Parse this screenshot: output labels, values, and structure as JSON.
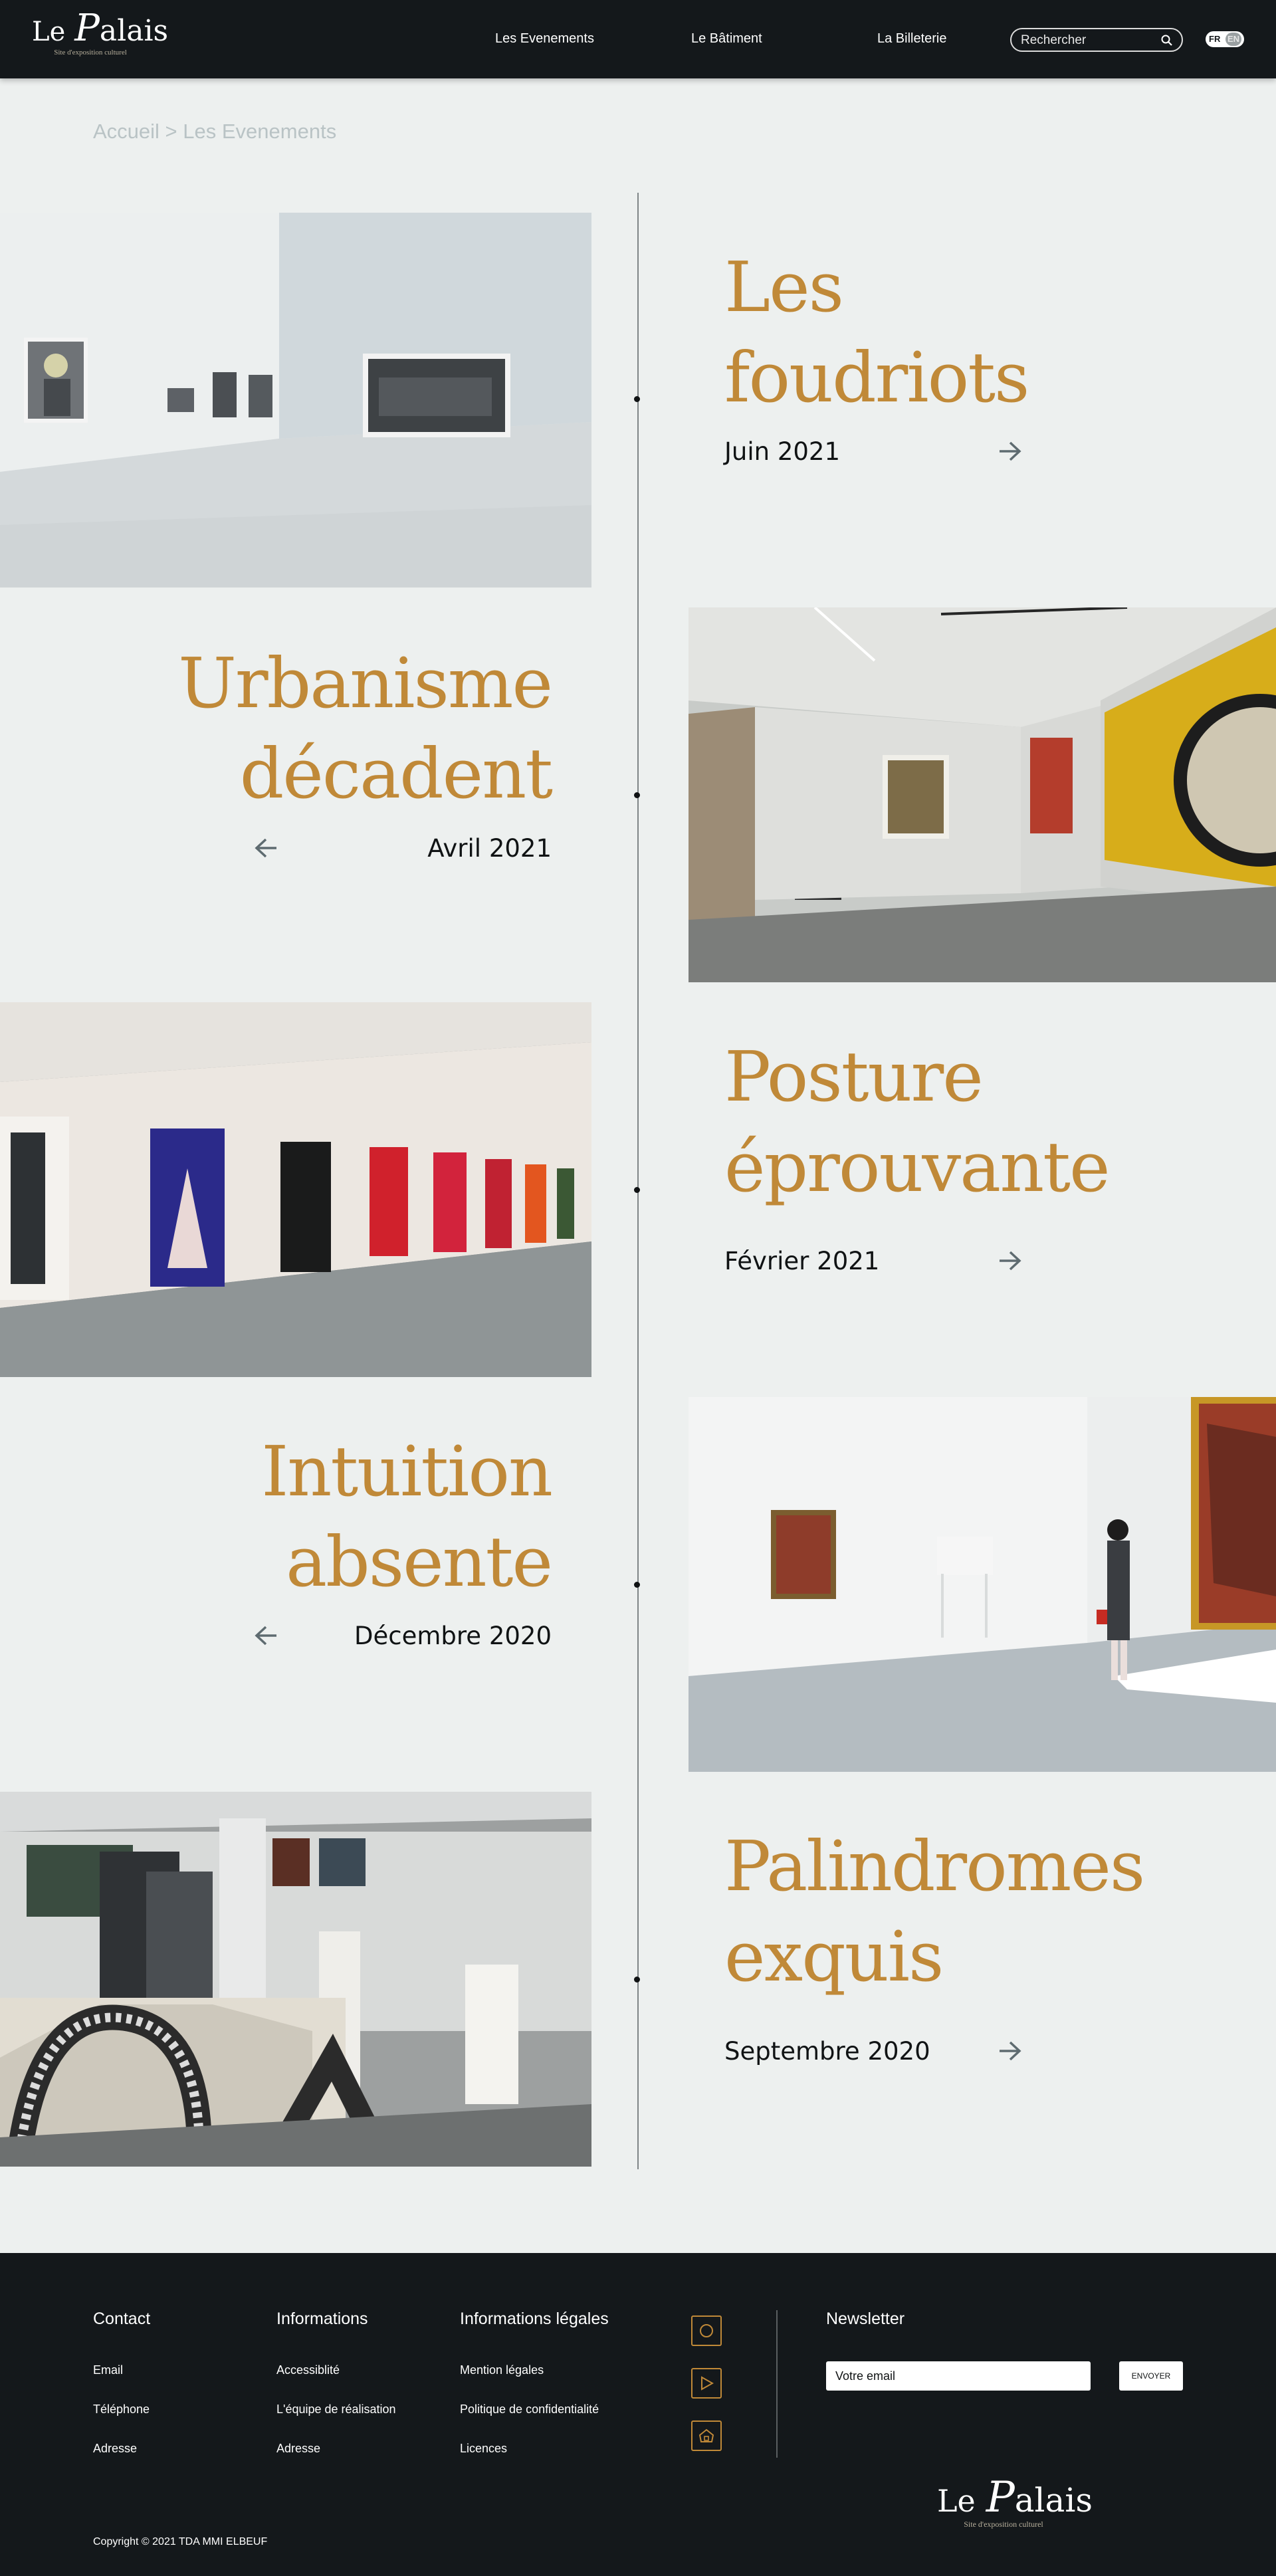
{
  "header": {
    "logo": {
      "le": "Le",
      "big": "P",
      "rest": "alais",
      "tagline": "Site d'exposition culturel"
    },
    "nav": [
      "Les Evenements",
      "Le Bâtiment",
      "La Billeterie"
    ],
    "search_placeholder": "Rechercher",
    "lang": {
      "fr": "FR",
      "en": "EN"
    }
  },
  "breadcrumb": {
    "home": "Accueil",
    "separator": " > ",
    "current": "Les Evenements"
  },
  "events": [
    {
      "title_lines": [
        "Les",
        "foudriots"
      ],
      "date": "Juin 2021"
    },
    {
      "title_lines": [
        "Urbanisme",
        "décadent"
      ],
      "date": "Avril 2021"
    },
    {
      "title_lines": [
        "Posture",
        "éprouvante"
      ],
      "date": "Février 2021"
    },
    {
      "title_lines": [
        "Intuition",
        "absente"
      ],
      "date": "Décembre 2020"
    },
    {
      "title_lines": [
        "Palindromes",
        "exquis"
      ],
      "date": "Septembre 2020"
    }
  ],
  "footer": {
    "columns": [
      {
        "heading": "Contact",
        "links": [
          "Email",
          "Téléphone",
          "Adresse"
        ]
      },
      {
        "heading": "Informations",
        "links": [
          "Accessiblité",
          "L'équipe de réalisation",
          "Adresse"
        ]
      },
      {
        "heading": "Informations légales",
        "links": [
          "Mention légales",
          "Politique de confidentialité",
          "Licences"
        ]
      }
    ],
    "social_icons": [
      "instagram-icon",
      "youtube-icon",
      "home-icon"
    ],
    "newsletter": {
      "heading": "Newsletter",
      "placeholder": "Votre email",
      "button": "ENVOYER"
    },
    "copyright": "Copyright © 2021 TDA MMI ELBEUF",
    "logo": {
      "le": "Le",
      "big": "P",
      "rest": "alais",
      "tagline": "Site d'exposition culturel"
    }
  },
  "colors": {
    "header_bg": "#14181b",
    "page_bg": "#edf0ef",
    "accent": "#c08938",
    "footer_bg": "#14181b"
  }
}
